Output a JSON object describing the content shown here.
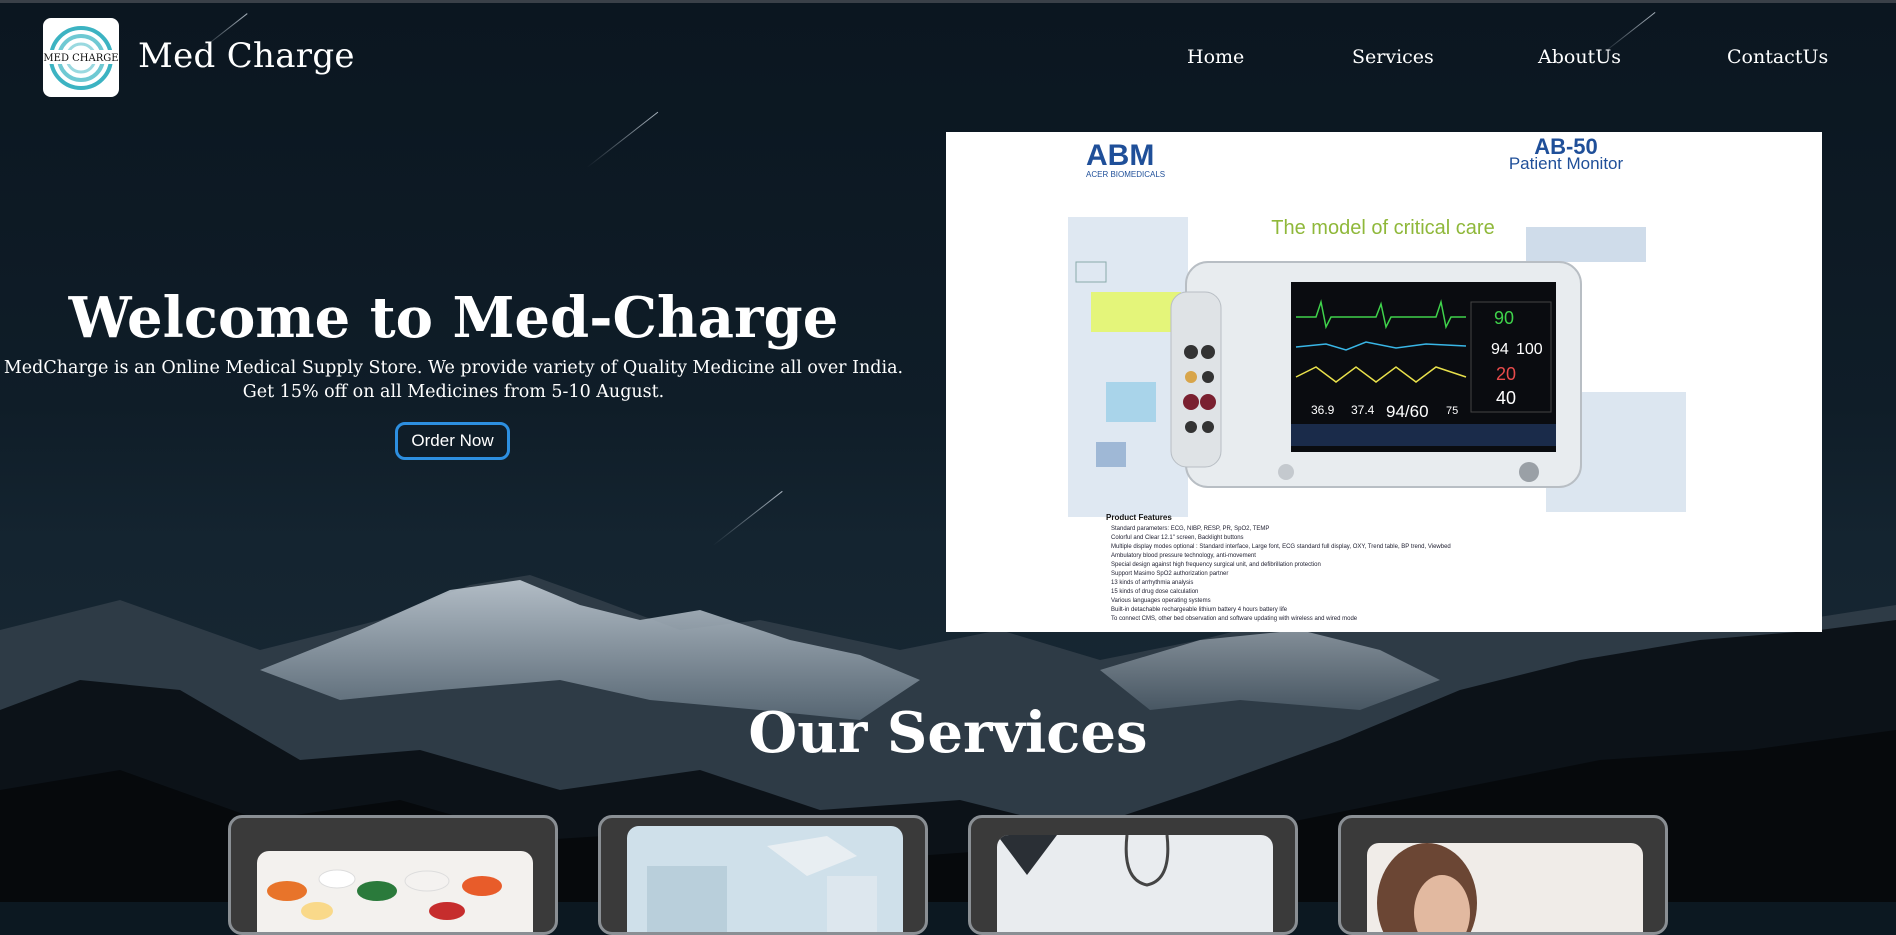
{
  "brand": {
    "name": "Med Charge",
    "logo_text": "MED CHARGE"
  },
  "nav": {
    "items": [
      "Home",
      "Services",
      "AboutUs",
      "ContactUs"
    ]
  },
  "hero": {
    "title": "Welcome to Med-Charge",
    "line1": "MedCharge is an Online Medical Supply Store. We provide variety of Quality Medicine all over India.",
    "line2": "Get 15% off on all Medicines from 5-10 August.",
    "button": "Order Now"
  },
  "monitor": {
    "brand": "ABM",
    "brand_sub": "ACER BIOMEDICALS",
    "model": "AB-50",
    "model_sub": "Patient Monitor",
    "tagline": "The model of critical care",
    "readings": [
      "90",
      "94",
      "100",
      "20",
      "40",
      "36.9",
      "37.4",
      "94/60",
      "75"
    ],
    "features_title": "Product Features",
    "features": [
      "Standard parameters: ECG, NIBP, RESP, PR, SpO2, TEMP",
      "Colorful and Clear 12.1\" screen, Backlight buttons",
      "Multiple display modes optional : Standard interface, Large font, ECG standard full display, OXY, Trend table, BP trend, Viewbed",
      "Ambulatory blood pressure technology, anti-movement",
      "Special design against high frequency surgical unit, and defibrillation protection",
      "Support Masimo SpO2 authorization partner",
      "13 kinds of arrhythmia analysis",
      "15 kinds of drug dose calculation",
      "Various languages operating systems",
      "Built-in detachable rechargeable lithium battery 4 hours battery life",
      "To connect CMS, other bed observation and software updating with wireless and wired mode"
    ]
  },
  "services": {
    "title": "Our Services"
  },
  "colors": {
    "accent": "#2d8fe0",
    "background": "#0c1821"
  }
}
